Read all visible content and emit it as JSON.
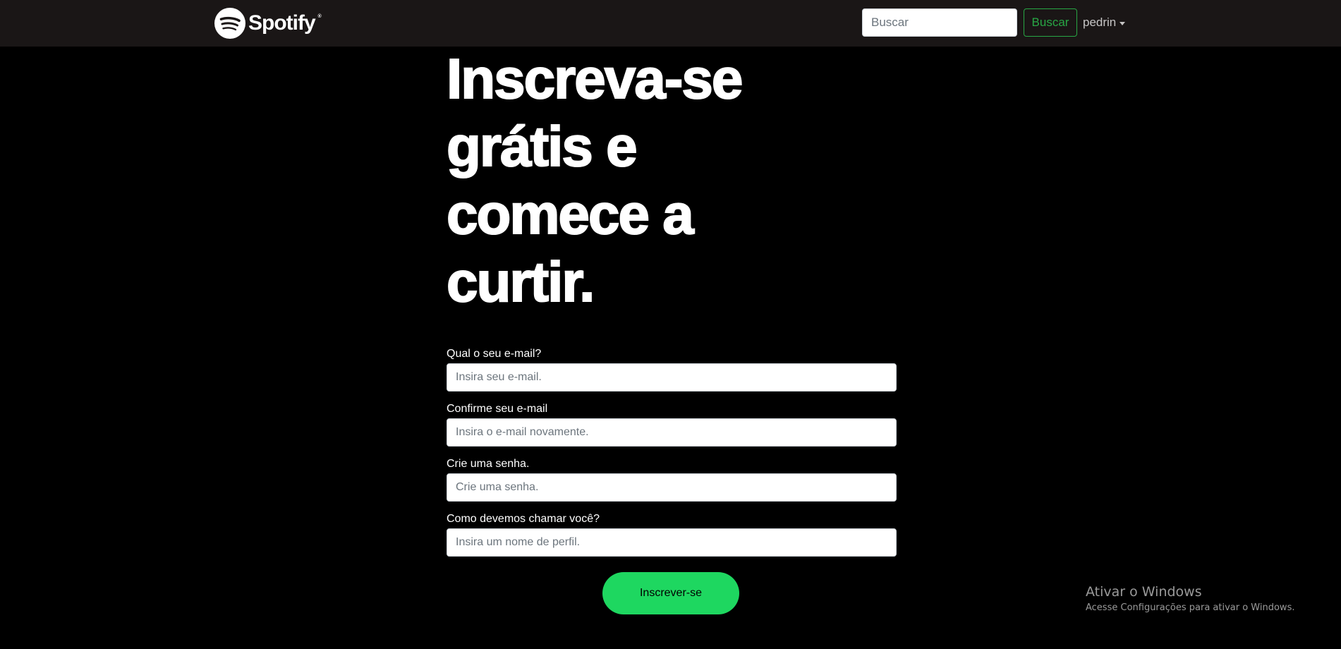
{
  "navbar": {
    "brand": {
      "icon": "spotify-logo-icon",
      "name": "Spotify",
      "registered_mark": "®"
    },
    "search": {
      "placeholder": "Buscar",
      "value": "",
      "button_label": "Buscar"
    },
    "user": {
      "name": "pedrin",
      "icon": "caret-down-icon"
    }
  },
  "hero": {
    "title": "Inscreva-se grátis e comece a curtir."
  },
  "form": {
    "fields": [
      {
        "label": "Qual o seu e-mail?",
        "placeholder": "Insira seu e-mail.",
        "value": ""
      },
      {
        "label": "Confirme seu e-mail",
        "placeholder": "Insira o e-mail novamente.",
        "value": ""
      },
      {
        "label": "Crie uma senha.",
        "placeholder": "Crie uma senha.",
        "value": ""
      },
      {
        "label": "Como devemos chamar você?",
        "placeholder": "Insira um nome de perfil.",
        "value": ""
      }
    ],
    "submit_label": "Inscrever-se"
  },
  "watermark": {
    "title": "Ativar o Windows",
    "subtitle": "Acesse Configurações para ativar o Windows."
  },
  "colors": {
    "background": "#000000",
    "navbar": "#1a1616",
    "accent_green": "#1ed760",
    "outline_green": "#28a745"
  }
}
